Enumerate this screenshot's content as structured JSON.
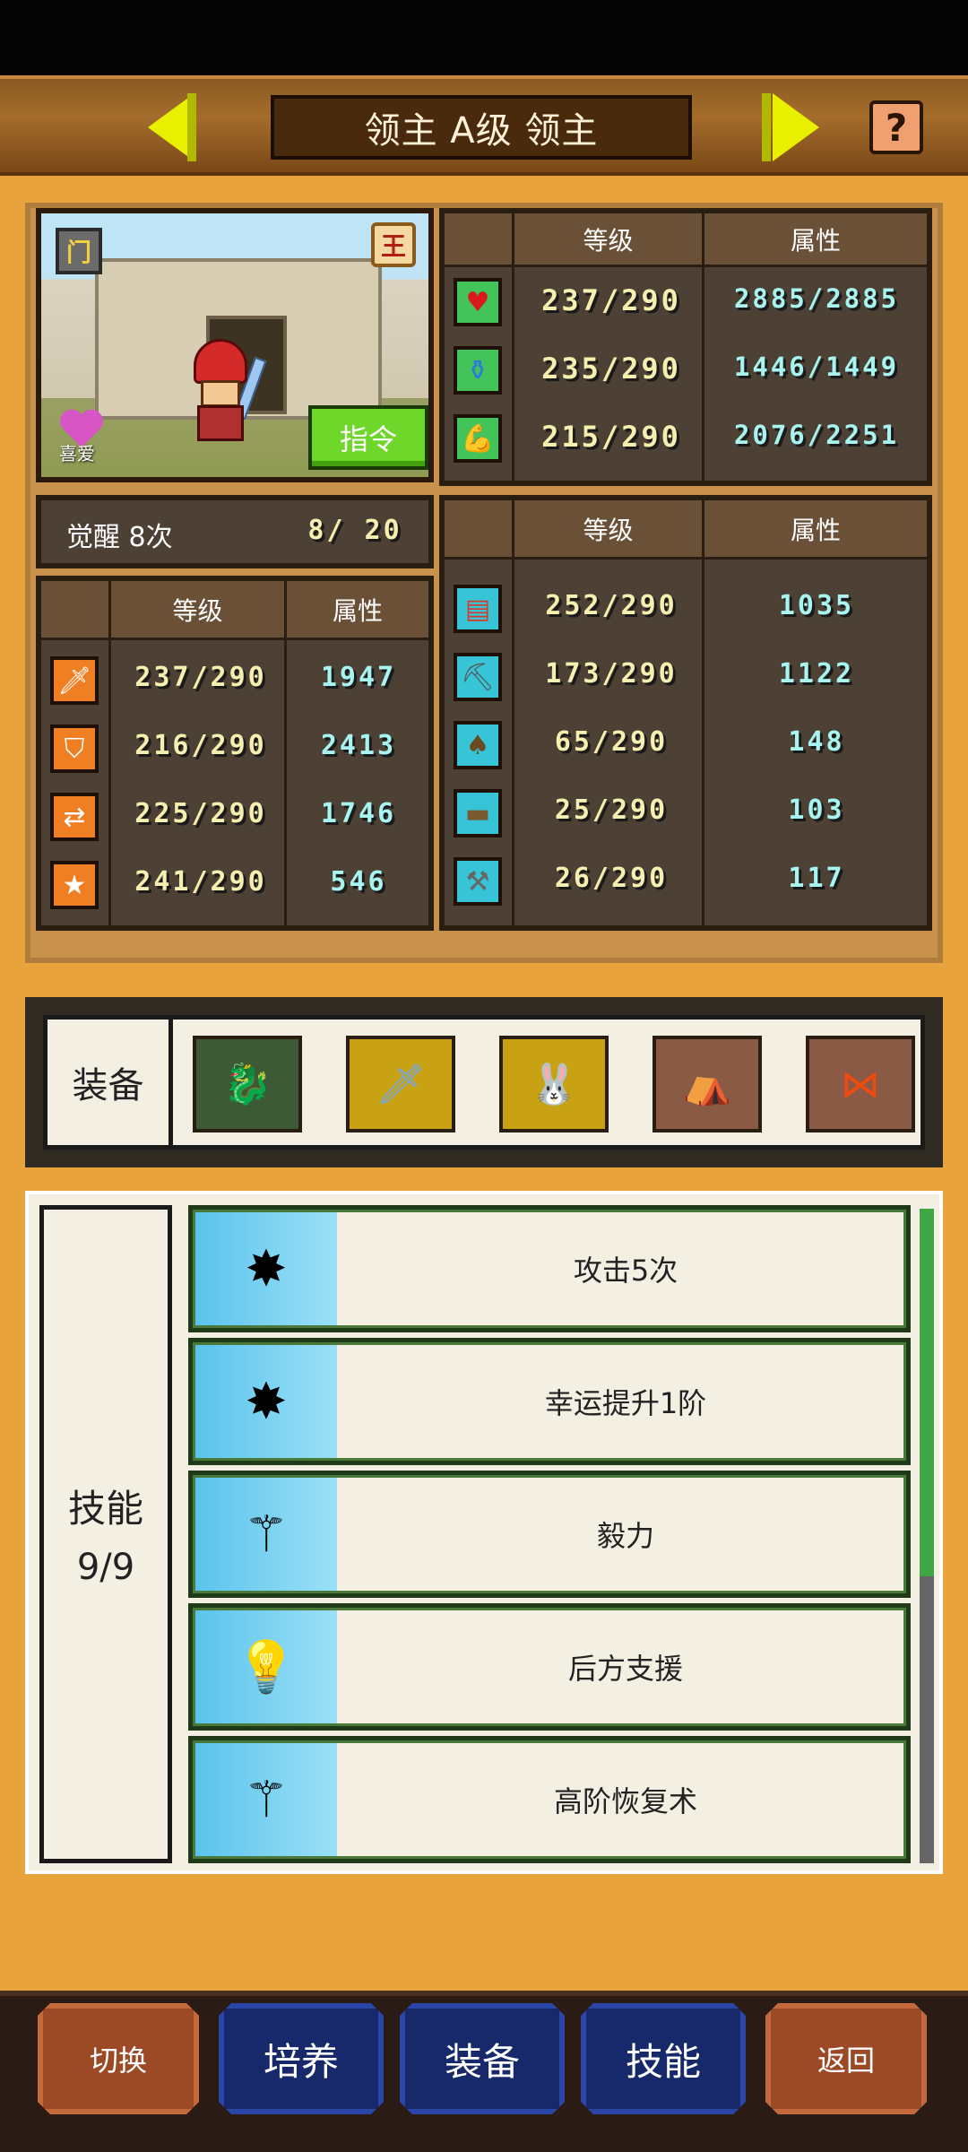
{
  "header": {
    "title": "领主 A级 领主",
    "help_symbol": "?"
  },
  "portrait": {
    "book_badge": "门",
    "king_badge": "王",
    "favorite_label": "喜爱",
    "command_label": "指令"
  },
  "vitals": {
    "col_level": "等级",
    "col_attr": "属性",
    "rows": [
      {
        "icon": "heart-icon",
        "level": "237/290",
        "attr": "2885/2885"
      },
      {
        "icon": "mana-potion-icon",
        "level": "235/290",
        "attr": "1446/1449"
      },
      {
        "icon": "stamina-arm-icon",
        "level": "215/290",
        "attr": "2076/2251"
      }
    ]
  },
  "awaken": {
    "label": "觉醒 8次",
    "progress": "8/ 20"
  },
  "combat": {
    "col_level": "等级",
    "col_attr": "属性",
    "rows": [
      {
        "icon": "sword-icon",
        "level": "237/290",
        "attr": "1947"
      },
      {
        "icon": "shield-icon",
        "level": "216/290",
        "attr": "2413"
      },
      {
        "icon": "arrows-icon",
        "level": "225/290",
        "attr": "1746"
      },
      {
        "icon": "star-icon",
        "level": "241/290",
        "attr": "546"
      }
    ]
  },
  "crafting": {
    "col_level": "等级",
    "col_attr": "属性",
    "rows": [
      {
        "icon": "book-icon",
        "level": "252/290",
        "attr": "1035"
      },
      {
        "icon": "pickaxe-icon",
        "level": "173/290",
        "attr": "1122"
      },
      {
        "icon": "shovel-icon",
        "level": "65/290",
        "attr": "148"
      },
      {
        "icon": "anvil-icon",
        "level": "25/290",
        "attr": "103"
      },
      {
        "icon": "hammer-icon",
        "level": "26/290",
        "attr": "117"
      }
    ]
  },
  "equipment": {
    "label": "装备",
    "slots": [
      {
        "icon": "dragon-weapon-icon",
        "bg": "#3c5a36"
      },
      {
        "icon": "crystal-sword-icon",
        "bg": "#c9a214"
      },
      {
        "icon": "bunny-charm-icon",
        "bg": "#c9a214"
      },
      {
        "icon": "green-robe-icon",
        "bg": "#8a5a44"
      },
      {
        "icon": "red-ribbon-icon",
        "bg": "#8a5a44"
      }
    ]
  },
  "skills": {
    "label": "技能",
    "count": "9/9",
    "items": [
      {
        "icon": "burst-sword-icon",
        "name": "攻击5次"
      },
      {
        "icon": "burst-sword-icon",
        "name": "幸运提升1阶"
      },
      {
        "icon": "magic-wand-icon",
        "name": "毅力"
      },
      {
        "icon": "lightbulb-icon",
        "name": "后方支援"
      },
      {
        "icon": "magic-wand-icon",
        "name": "高阶恢复术"
      }
    ]
  },
  "bottom_nav": {
    "switch": "切换",
    "train": "培养",
    "equip": "装备",
    "skill": "技能",
    "back": "返回"
  },
  "colors": {
    "background": "#e8a33c",
    "panel_dark": "#4d4034",
    "value_text": "#f6f0b0",
    "value_text_cyan": "#a8f4f0",
    "skill_icon_bg": "#5bc4ec",
    "button_blue": "#17296b",
    "button_brown": "#9c4a26",
    "command_green": "#6fd62a"
  }
}
